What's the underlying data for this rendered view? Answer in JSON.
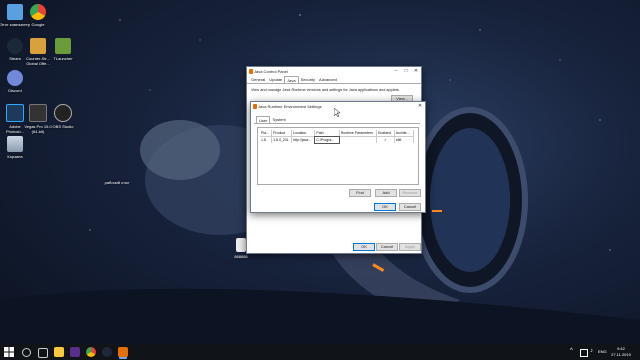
{
  "desktop": {
    "icons": [
      {
        "label": "Этот компьютер",
        "icon": "computer-icon"
      },
      {
        "label": "Google",
        "icon": "chrome-icon"
      },
      {
        "label": "Steam",
        "icon": "steam-icon"
      },
      {
        "label": "Counter-Str... Global Offe...",
        "icon": "csgo-icon"
      },
      {
        "label": "TLauncher",
        "icon": "minecraft-icon"
      },
      {
        "label": "Discord",
        "icon": "discord-icon"
      },
      {
        "label": "Adobe Photosh...",
        "icon": "photoshop-icon"
      },
      {
        "label": "Vegas Pro 15.0 (64-bit)",
        "icon": "vegas-icon"
      },
      {
        "label": "OBS Studio",
        "icon": "obs-icon"
      },
      {
        "label": "Корзина",
        "icon": "recycle-bin-icon"
      },
      {
        "label": "рабочий стол",
        "icon": "folder-icon"
      },
      {
        "label": "888888",
        "icon": "file-icon"
      }
    ]
  },
  "jcp": {
    "title": "Java Control Panel",
    "tabs": [
      "General",
      "Update",
      "Java",
      "Security",
      "Advanced"
    ],
    "active_tab": "Java",
    "description": "View and manage Java Runtime versions and settings for Java applications and applets.",
    "view_button": "View...",
    "ok": "OK",
    "cancel": "Cancel",
    "apply": "Apply"
  },
  "jre": {
    "title": "Java Runtime Environment Settings",
    "tabs": [
      "User",
      "System"
    ],
    "active_tab": "User",
    "columns": [
      "Pla...",
      "Product",
      "Location",
      "Path",
      "Runtime Parameters",
      "Enabled",
      "Archite..."
    ],
    "rows": [
      {
        "platform": "1.8",
        "product": "1.8.0_201",
        "location": "http://java...",
        "path": "C:\\Progra...",
        "params": "",
        "enabled": "✓",
        "arch": "x86"
      }
    ],
    "find": "Find",
    "add": "Add",
    "remove": "Remove",
    "ok": "OK",
    "cancel": "Cancel"
  },
  "taskbar": {
    "time": "9:42",
    "date": "27.11.2019",
    "lang": "ENG"
  }
}
